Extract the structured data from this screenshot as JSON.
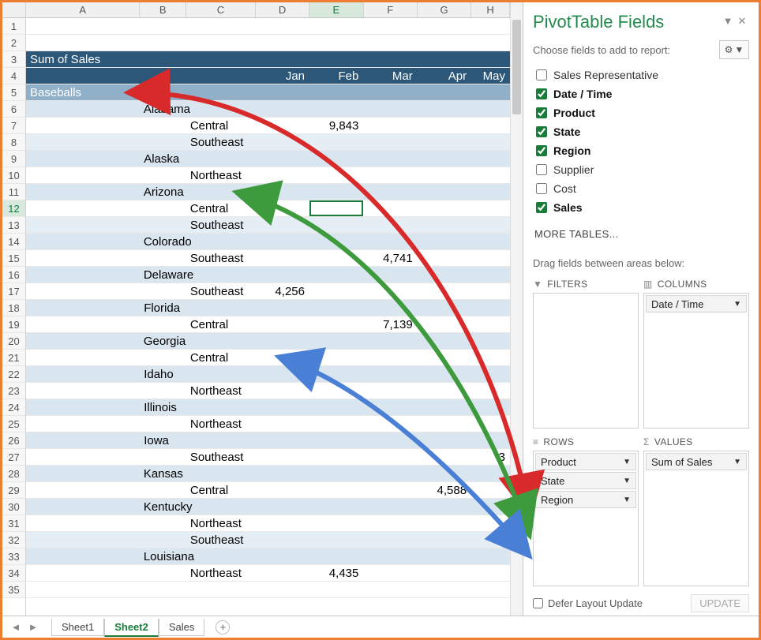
{
  "columns": [
    "A",
    "B",
    "C",
    "D",
    "E",
    "F",
    "G",
    "H"
  ],
  "active_column_index": 4,
  "row_numbers": [
    1,
    2,
    3,
    4,
    5,
    6,
    7,
    8,
    9,
    10,
    11,
    12,
    13,
    14,
    15,
    16,
    17,
    18,
    19,
    20,
    21,
    22,
    23,
    24,
    25,
    26,
    27,
    28,
    29,
    30,
    31,
    32,
    33,
    34,
    35
  ],
  "active_row_number": 12,
  "header": {
    "title": "Sum of Sales",
    "months": [
      "Jan",
      "Feb",
      "Mar",
      "Apr",
      "May"
    ]
  },
  "product_row": "Baseballs",
  "data_rows": [
    {
      "state": "Alabama",
      "children": [
        {
          "region": "Central",
          "vals": {
            "E": "9,843"
          }
        },
        {
          "region": "Southeast",
          "vals": {}
        }
      ]
    },
    {
      "state": "Alaska",
      "children": [
        {
          "region": "Northeast",
          "vals": {}
        }
      ]
    },
    {
      "state": "Arizona",
      "children": [
        {
          "region": "Central",
          "vals": {}
        },
        {
          "region": "Southeast",
          "vals": {}
        }
      ]
    },
    {
      "state": "Colorado",
      "children": [
        {
          "region": "Southeast",
          "vals": {
            "F": "4,741"
          }
        }
      ]
    },
    {
      "state": "Delaware",
      "children": [
        {
          "region": "Southeast",
          "vals": {
            "D": "4,256"
          }
        }
      ]
    },
    {
      "state": "Florida",
      "children": [
        {
          "region": "Central",
          "vals": {
            "F": "7,139"
          }
        }
      ]
    },
    {
      "state": "Georgia",
      "children": [
        {
          "region": "Central",
          "vals": {}
        }
      ]
    },
    {
      "state": "Idaho",
      "children": [
        {
          "region": "Northeast",
          "vals": {}
        }
      ]
    },
    {
      "state": "Illinois",
      "children": [
        {
          "region": "Northeast",
          "vals": {}
        }
      ]
    },
    {
      "state": "Iowa",
      "children": [
        {
          "region": "Southeast",
          "vals": {
            "H": "3"
          }
        }
      ]
    },
    {
      "state": "Kansas",
      "children": [
        {
          "region": "Central",
          "vals": {
            "G": "4,588"
          }
        }
      ]
    },
    {
      "state": "Kentucky",
      "children": [
        {
          "region": "Northeast",
          "vals": {}
        },
        {
          "region": "Southeast",
          "vals": {}
        }
      ]
    },
    {
      "state": "Louisiana",
      "children": [
        {
          "region": "Northeast",
          "vals": {
            "E": "4,435"
          }
        }
      ]
    }
  ],
  "pane": {
    "title": "PivotTable Fields",
    "subtitle": "Choose fields to add to report:",
    "fields": [
      {
        "label": "Sales Representative",
        "checked": false
      },
      {
        "label": "Date / Time",
        "checked": true
      },
      {
        "label": "Product",
        "checked": true
      },
      {
        "label": "State",
        "checked": true
      },
      {
        "label": "Region",
        "checked": true
      },
      {
        "label": "Supplier",
        "checked": false
      },
      {
        "label": "Cost",
        "checked": false
      },
      {
        "label": "Sales",
        "checked": true
      }
    ],
    "more": "MORE TABLES...",
    "dragline": "Drag fields between areas below:",
    "areas": {
      "filters": {
        "label": "FILTERS",
        "icon": "▼",
        "chips": []
      },
      "columns": {
        "label": "COLUMNS",
        "icon": "▥",
        "chips": [
          "Date / Time"
        ]
      },
      "rows": {
        "label": "ROWS",
        "icon": "≡",
        "chips": [
          "Product",
          "State",
          "Region"
        ]
      },
      "values": {
        "label": "VALUES",
        "icon": "Σ",
        "chips": [
          "Sum of Sales"
        ]
      }
    },
    "defer": "Defer Layout Update",
    "update": "UPDATE"
  },
  "tabs": {
    "items": [
      "Sheet1",
      "Sheet2",
      "Sales"
    ],
    "active": "Sheet2"
  }
}
